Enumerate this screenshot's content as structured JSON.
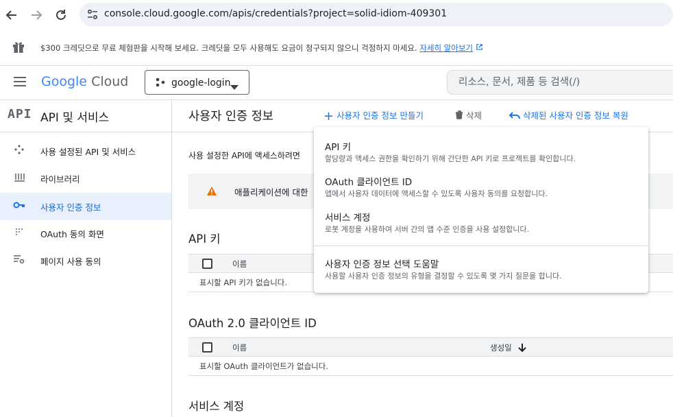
{
  "browser": {
    "url": "console.cloud.google.com/apis/credentials?project=solid-idiom-409301"
  },
  "banner": {
    "text": "$300 크레딧으로 무료 체험판을 시작해 보세요. 크레딧을 모두 사용해도 요금이 청구되지 않으니 걱정하지 마세요.",
    "link": "자세히 알아보기"
  },
  "header": {
    "logo_google": "Google",
    "logo_cloud": "Cloud",
    "project": "google-login",
    "search_placeholder": "리소스, 문서, 제품 등 검색(/)"
  },
  "sidebar": {
    "badge": "API",
    "title": "API 및 서비스",
    "items": [
      {
        "label": "사용 설정된 API 및 서비스",
        "icon": "diamond-icon"
      },
      {
        "label": "라이브러리",
        "icon": "library-icon"
      },
      {
        "label": "사용자 인증 정보",
        "icon": "key-icon"
      },
      {
        "label": "OAuth 동의 화면",
        "icon": "dots-icon"
      },
      {
        "label": "페이지 사용 동의",
        "icon": "settings-list-icon"
      }
    ]
  },
  "main": {
    "title": "사용자 인증 정보",
    "toolbar": {
      "create": "사용자 인증 정보 만들기",
      "delete": "삭제",
      "restore": "삭제된 사용자 인증 정보 복원"
    },
    "intro": "사용 설정한 API에 액세스하려면",
    "warning": "애플리케이션에 대한",
    "sections": {
      "api_keys": {
        "title": "API 키",
        "col_name": "이름",
        "empty": "표시할 API 키가 없습니다."
      },
      "oauth": {
        "title": "OAuth 2.0 클라이언트 ID",
        "col_name": "이름",
        "col_created": "생성일",
        "empty": "표시할 OAuth 클라이언트가 없습니다."
      },
      "service_accounts": {
        "title": "서비스 계정"
      }
    }
  },
  "dropdown": {
    "items": [
      {
        "title": "API 키",
        "desc": "할당량과 액세스 권한을 확인하기 위해 간단한 API 키로 프로젝트를 확인합니다."
      },
      {
        "title": "OAuth 클라이언트 ID",
        "desc": "앱에서 사용자 데이터에 액세스할 수 있도록 사용자 동의를 요청합니다."
      },
      {
        "title": "서비스 계정",
        "desc": "로봇 계정을 사용하여 서버 간의 앱 수준 인증을 사용 설정합니다."
      },
      {
        "title": "사용자 인증 정보 선택 도움말",
        "desc": "사용할 사용자 인증 정보의 유형을 결정할 수 있도록 몇 가지 질문을 합니다."
      }
    ]
  },
  "colors": {
    "accent": "#1a73e8",
    "active_bg": "#e8f0fe",
    "warning": "#e37400"
  }
}
